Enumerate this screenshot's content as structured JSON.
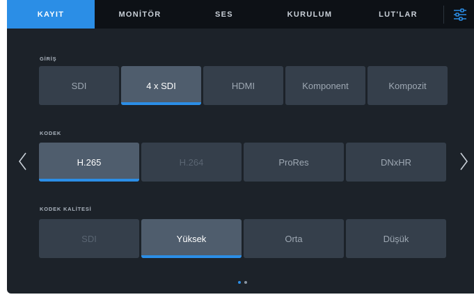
{
  "tabs": [
    {
      "label": "KAYIT",
      "active": true
    },
    {
      "label": "MONİTÖR",
      "active": false
    },
    {
      "label": "SES",
      "active": false
    },
    {
      "label": "KURULUM",
      "active": false
    },
    {
      "label": "LUT'LAR",
      "active": false
    }
  ],
  "menu_icon": "sliders-icon",
  "sections": {
    "input": {
      "label": "GİRİŞ",
      "options": [
        "SDI",
        "4 x SDI",
        "HDMI",
        "Komponent",
        "Kompozit"
      ],
      "selected": "4 x SDI"
    },
    "codec": {
      "label": "KODEK",
      "options": [
        "H.265",
        "H.264",
        "ProRes",
        "DNxHR"
      ],
      "selected": "H.265",
      "disabled": [
        "H.264"
      ]
    },
    "quality": {
      "label": "KODEK KALİTESİ",
      "options": [
        "SDI",
        "Yüksek",
        "Orta",
        "Düşük"
      ],
      "selected": "Yüksek",
      "disabled": [
        "SDI"
      ]
    }
  },
  "nav": {
    "prev_icon": "chevron-left-icon",
    "next_icon": "chevron-right-icon"
  },
  "pagination": {
    "pages": 2,
    "current": 1
  },
  "colors": {
    "accent": "#2b8ee6",
    "background": "#1c2229",
    "tabbar": "#0d1116",
    "button": "#353f4b",
    "button_selected": "#4f5d6d"
  }
}
